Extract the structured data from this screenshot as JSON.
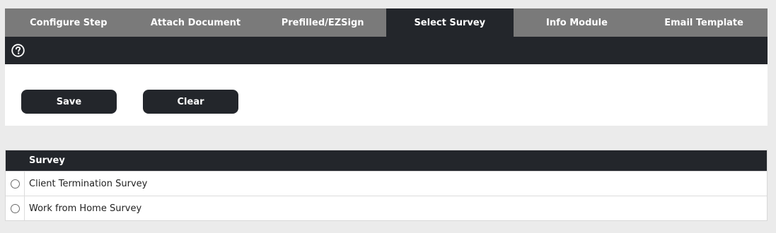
{
  "tabs": [
    {
      "label": "Configure Step",
      "active": false
    },
    {
      "label": "Attach Document",
      "active": false
    },
    {
      "label": "Prefilled/EZSign",
      "active": false
    },
    {
      "label": "Select Survey",
      "active": true
    },
    {
      "label": "Info Module",
      "active": false
    },
    {
      "label": "Email Template",
      "active": false
    }
  ],
  "toolbar": {
    "help_icon": "help-circle-icon"
  },
  "actions": {
    "save_label": "Save",
    "clear_label": "Clear"
  },
  "survey_table": {
    "header": "Survey",
    "rows": [
      {
        "name": "Client Termination Survey",
        "selected": false
      },
      {
        "name": "Work from Home Survey",
        "selected": false
      }
    ]
  },
  "colors": {
    "dark": "#23262b",
    "tab_bar": "#7a7a7a",
    "background": "#ebebeb"
  }
}
